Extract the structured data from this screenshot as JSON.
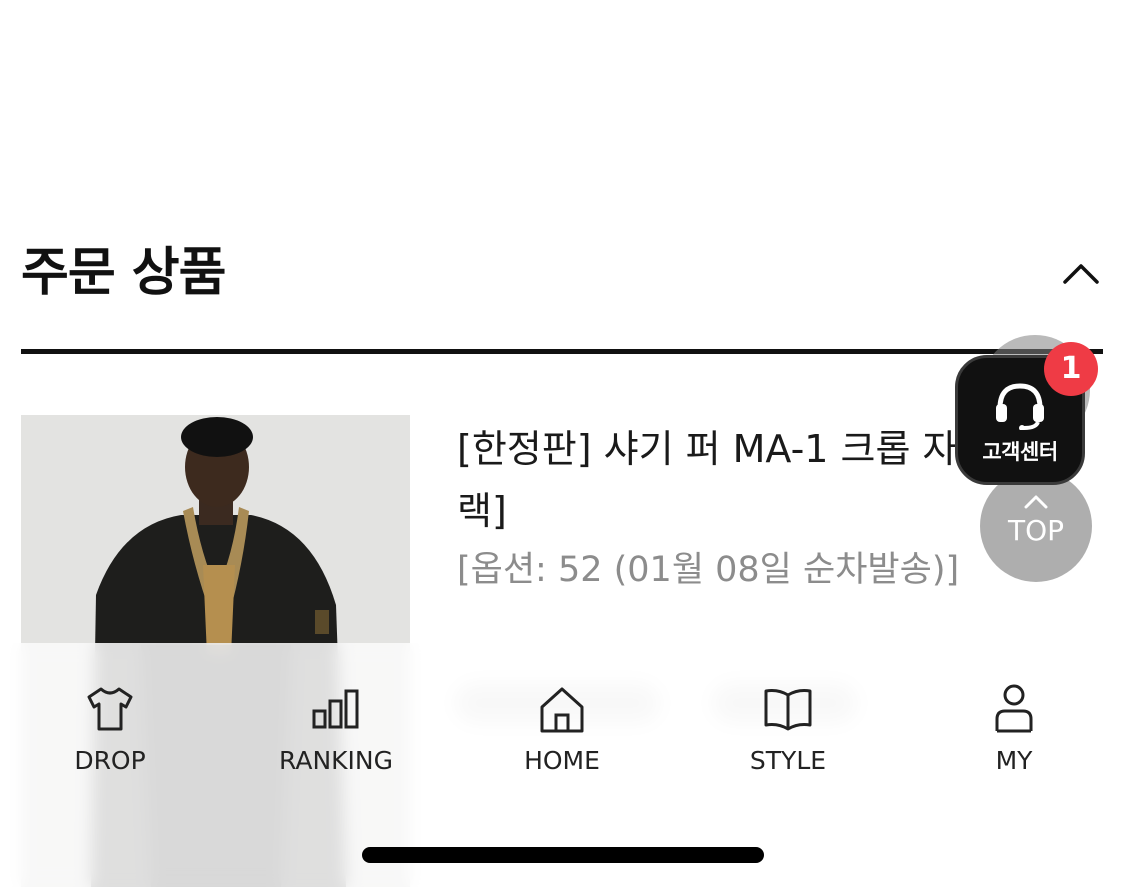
{
  "section": {
    "title": "주문 상품",
    "collapse_icon": "chevron-up-icon"
  },
  "product": {
    "name": "[한정판] 샤기 퍼 MA-1 크롭 자켓 [블랙]",
    "option": "[옵션: 52 (01월 08일 순차발송)]",
    "image_icon": "product-photo-jacket"
  },
  "floating": {
    "top_label": "TOP",
    "cs_label": "고객센터",
    "cs_badge": "1",
    "badge_color": "#ef3b45"
  },
  "bottom_nav": {
    "items": [
      {
        "label": "DROP",
        "icon": "tshirt-icon"
      },
      {
        "label": "RANKING",
        "icon": "ranking-bars-icon"
      },
      {
        "label": "HOME",
        "icon": "home-icon"
      },
      {
        "label": "STYLE",
        "icon": "book-icon"
      },
      {
        "label": "MY",
        "icon": "person-icon"
      }
    ]
  }
}
